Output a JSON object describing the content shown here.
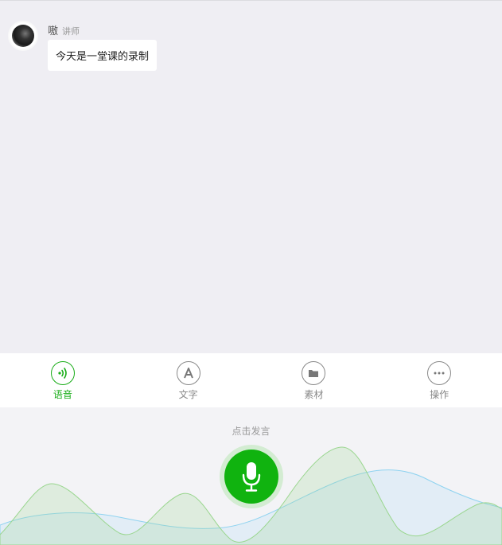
{
  "message": {
    "sender": "嗷",
    "role": "讲师",
    "text": "今天是一堂课的录制"
  },
  "tabs": [
    {
      "label": "语音",
      "icon": "voice-icon",
      "active": true
    },
    {
      "label": "文字",
      "icon": "text-a-icon",
      "active": false
    },
    {
      "label": "素材",
      "icon": "folder-icon",
      "active": false
    },
    {
      "label": "操作",
      "icon": "more-dots-icon",
      "active": false
    }
  ],
  "recorder": {
    "hint": "点击发言",
    "icon": "microphone-icon"
  },
  "colors": {
    "accent": "#1aad19",
    "mic": "#10b30f",
    "background": "#efeef3"
  }
}
